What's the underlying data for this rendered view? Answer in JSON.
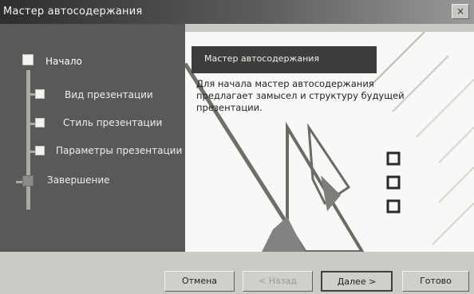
{
  "window": {
    "title": "Мастер автосодержания",
    "close_glyph": "×"
  },
  "steps": {
    "items": [
      {
        "label": "Начало",
        "active": true
      },
      {
        "label": "Вид презентации",
        "active": false
      },
      {
        "label": "Стиль презентации",
        "active": false
      },
      {
        "label": "Параметры презентации",
        "active": false
      },
      {
        "label": "Завершение",
        "active": false
      }
    ]
  },
  "content": {
    "header": "Мастер автосодержания",
    "description_lines": [
      "Для начала мастер автосодержания",
      "предлагает замысел и структуру будущей",
      "презентации."
    ]
  },
  "buttons": {
    "cancel": "Отмена",
    "back": "< Назад",
    "next": "Далее >",
    "finish": "Готово"
  },
  "colors": {
    "steps_panel": "#595957",
    "header_band": "#3d3d3b",
    "content_bg": "#f8f8f6"
  },
  "icons": [
    "close-icon",
    "step-marker-icon",
    "checkbox-illustration-icon"
  ]
}
